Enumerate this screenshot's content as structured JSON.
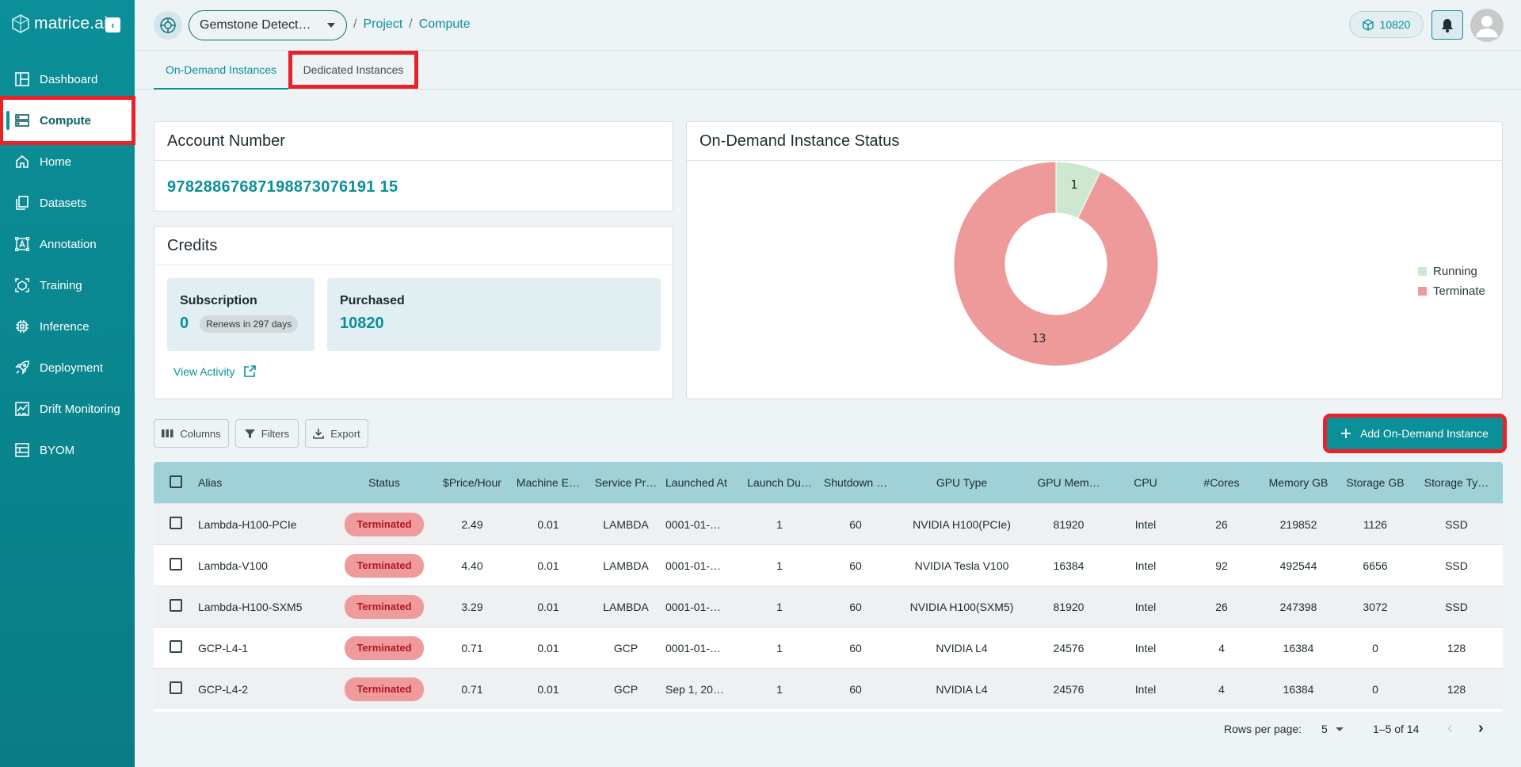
{
  "brand": {
    "name": "matrice.ai"
  },
  "sidebar": {
    "items": [
      {
        "label": "Dashboard",
        "icon": "dashboard-icon"
      },
      {
        "label": "Compute",
        "icon": "compute-icon",
        "active": true
      },
      {
        "label": "Home",
        "icon": "home-icon"
      },
      {
        "label": "Datasets",
        "icon": "datasets-icon"
      },
      {
        "label": "Annotation",
        "icon": "annotation-icon"
      },
      {
        "label": "Training",
        "icon": "training-icon"
      },
      {
        "label": "Inference",
        "icon": "inference-icon"
      },
      {
        "label": "Deployment",
        "icon": "deployment-icon"
      },
      {
        "label": "Drift Monitoring",
        "icon": "drift-icon"
      },
      {
        "label": "BYOM",
        "icon": "byom-icon"
      }
    ]
  },
  "header": {
    "project": "Gemstone Detect…",
    "breadcrumb": {
      "sep": "/",
      "project": "Project",
      "current": "Compute"
    },
    "credits": "10820"
  },
  "tabs": {
    "on_demand": "On-Demand Instances",
    "dedicated": "Dedicated Instances"
  },
  "account": {
    "title": "Account Number",
    "number": "97828867687198873076191 15"
  },
  "credits": {
    "title": "Credits",
    "subscription_label": "Subscription",
    "subscription_value": "0",
    "renews": "Renews in 297 days",
    "purchased_label": "Purchased",
    "purchased_value": "10820",
    "view_activity": "View Activity"
  },
  "chart_data": {
    "type": "pie",
    "title": "On-Demand Instance Status",
    "categories": [
      "Running",
      "Terminate"
    ],
    "values": [
      1,
      13
    ],
    "colors": [
      "#cde8cf",
      "#ee9a9b"
    ],
    "legend": "right"
  },
  "toolbar": {
    "columns": "Columns",
    "filters": "Filters",
    "export": "Export",
    "add": "Add On-Demand Instance"
  },
  "table": {
    "columns": [
      "Alias",
      "Status",
      "$Price/Hour",
      "Machine E…",
      "Service Pr…",
      "Launched At",
      "Launch Du…",
      "Shutdown …",
      "GPU Type",
      "GPU Mem…",
      "CPU",
      "#Cores",
      "Memory GB",
      "Storage GB",
      "Storage Ty…"
    ],
    "rows": [
      [
        "Lambda-H100-PCIe",
        "Terminated",
        "2.49",
        "0.01",
        "LAMBDA",
        "0001-01-…",
        "1",
        "60",
        "NVIDIA H100(PCIe)",
        "81920",
        "Intel",
        "26",
        "219852",
        "1126",
        "SSD"
      ],
      [
        "Lambda-V100",
        "Terminated",
        "4.40",
        "0.01",
        "LAMBDA",
        "0001-01-…",
        "1",
        "60",
        "NVIDIA Tesla V100",
        "16384",
        "Intel",
        "92",
        "492544",
        "6656",
        "SSD"
      ],
      [
        "Lambda-H100-SXM5",
        "Terminated",
        "3.29",
        "0.01",
        "LAMBDA",
        "0001-01-…",
        "1",
        "60",
        "NVIDIA H100(SXM5)",
        "81920",
        "Intel",
        "26",
        "247398",
        "3072",
        "SSD"
      ],
      [
        "GCP-L4-1",
        "Terminated",
        "0.71",
        "0.01",
        "GCP",
        "0001-01-…",
        "1",
        "60",
        "NVIDIA L4",
        "24576",
        "Intel",
        "4",
        "16384",
        "0",
        "128"
      ],
      [
        "GCP-L4-2",
        "Terminated",
        "0.71",
        "0.01",
        "GCP",
        "Sep 1, 20…",
        "1",
        "60",
        "NVIDIA L4",
        "24576",
        "Intel",
        "4",
        "16384",
        "0",
        "128"
      ]
    ]
  },
  "pagination": {
    "rows_label": "Rows per page:",
    "rows_value": "5",
    "range": "1–5 of 14"
  }
}
